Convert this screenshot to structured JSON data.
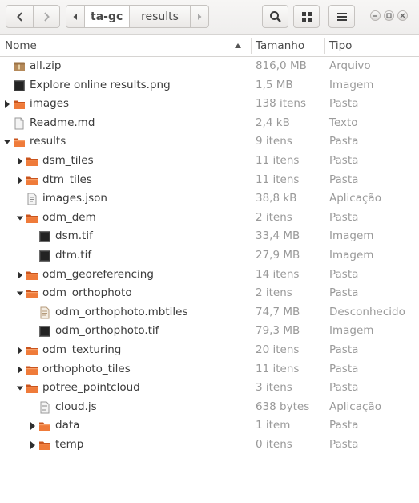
{
  "toolbar": {
    "back_icon": "chevron-left-icon",
    "forward_icon": "chevron-right-icon",
    "path": [
      "ta-gc",
      "results"
    ],
    "search_icon": "search-icon",
    "view_icon": "grid-view-icon",
    "menu_icon": "hamburger-menu-icon"
  },
  "columns": {
    "name": "Nome",
    "size": "Tamanho",
    "type": "Tipo"
  },
  "rows": [
    {
      "name": "all.zip",
      "size": "816,0 MB",
      "type": "Arquivo",
      "icon": "archive-icon",
      "depth": 0,
      "expander": "none"
    },
    {
      "name": "Explore online results.png",
      "size": "1,5 MB",
      "type": "Imagem",
      "icon": "image-file-icon",
      "depth": 0,
      "expander": "none"
    },
    {
      "name": "images",
      "size": "138 itens",
      "type": "Pasta",
      "icon": "folder-icon",
      "depth": 0,
      "expander": "collapsed"
    },
    {
      "name": "Readme.md",
      "size": "2,4 kB",
      "type": "Texto",
      "icon": "text-file-icon",
      "depth": 0,
      "expander": "none"
    },
    {
      "name": "results",
      "size": "9 itens",
      "type": "Pasta",
      "icon": "folder-icon",
      "depth": 0,
      "expander": "expanded"
    },
    {
      "name": "dsm_tiles",
      "size": "11 itens",
      "type": "Pasta",
      "icon": "folder-icon",
      "depth": 1,
      "expander": "collapsed"
    },
    {
      "name": "dtm_tiles",
      "size": "11 itens",
      "type": "Pasta",
      "icon": "folder-icon",
      "depth": 1,
      "expander": "collapsed"
    },
    {
      "name": "images.json",
      "size": "38,8 kB",
      "type": "Aplicação",
      "icon": "json-file-icon",
      "depth": 1,
      "expander": "none"
    },
    {
      "name": "odm_dem",
      "size": "2 itens",
      "type": "Pasta",
      "icon": "folder-icon",
      "depth": 1,
      "expander": "expanded"
    },
    {
      "name": "dsm.tif",
      "size": "33,4 MB",
      "type": "Imagem",
      "icon": "image-file-icon",
      "depth": 2,
      "expander": "none"
    },
    {
      "name": "dtm.tif",
      "size": "27,9 MB",
      "type": "Imagem",
      "icon": "image-file-icon",
      "depth": 2,
      "expander": "none"
    },
    {
      "name": "odm_georeferencing",
      "size": "14 itens",
      "type": "Pasta",
      "icon": "folder-icon",
      "depth": 1,
      "expander": "collapsed"
    },
    {
      "name": "odm_orthophoto",
      "size": "2 itens",
      "type": "Pasta",
      "icon": "folder-icon",
      "depth": 1,
      "expander": "expanded"
    },
    {
      "name": "odm_orthophoto.mbtiles",
      "size": "74,7 MB",
      "type": "Desconhecido",
      "icon": "unknown-file-icon",
      "depth": 2,
      "expander": "none"
    },
    {
      "name": "odm_orthophoto.tif",
      "size": "79,3 MB",
      "type": "Imagem",
      "icon": "image-file-icon",
      "depth": 2,
      "expander": "none"
    },
    {
      "name": "odm_texturing",
      "size": "20 itens",
      "type": "Pasta",
      "icon": "folder-icon",
      "depth": 1,
      "expander": "collapsed"
    },
    {
      "name": "orthophoto_tiles",
      "size": "11 itens",
      "type": "Pasta",
      "icon": "folder-icon",
      "depth": 1,
      "expander": "collapsed"
    },
    {
      "name": "potree_pointcloud",
      "size": "3 itens",
      "type": "Pasta",
      "icon": "folder-icon",
      "depth": 1,
      "expander": "expanded"
    },
    {
      "name": "cloud.js",
      "size": "638 bytes",
      "type": "Aplicação",
      "icon": "script-file-icon",
      "depth": 2,
      "expander": "none"
    },
    {
      "name": "data",
      "size": "1 item",
      "type": "Pasta",
      "icon": "folder-icon",
      "depth": 2,
      "expander": "collapsed"
    },
    {
      "name": "temp",
      "size": "0 itens",
      "type": "Pasta",
      "icon": "folder-icon",
      "depth": 2,
      "expander": "collapsed"
    }
  ]
}
